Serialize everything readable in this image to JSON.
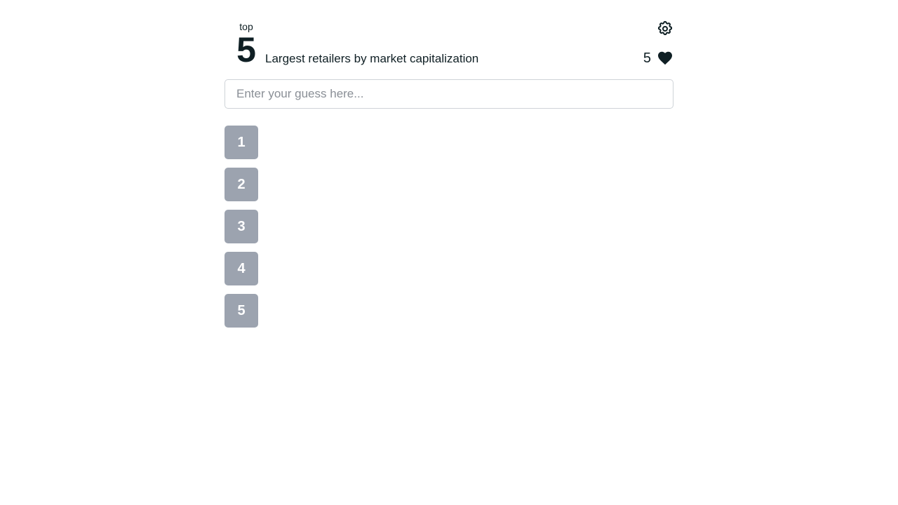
{
  "header": {
    "logo_top": "top",
    "logo_number": "5",
    "title": "Largest retailers by market capitalization",
    "settings_icon": "gear-icon",
    "lives_count": "5",
    "lives_icon": "heart-icon"
  },
  "guess": {
    "placeholder": "Enter your guess here...",
    "value": ""
  },
  "slots": [
    {
      "rank": "1",
      "answer": ""
    },
    {
      "rank": "2",
      "answer": ""
    },
    {
      "rank": "3",
      "answer": ""
    },
    {
      "rank": "4",
      "answer": ""
    },
    {
      "rank": "5",
      "answer": ""
    }
  ],
  "colors": {
    "text": "#0f1f24",
    "slot_background": "#9ca3af",
    "slot_text": "#ffffff",
    "input_border": "#cfd3d8"
  }
}
